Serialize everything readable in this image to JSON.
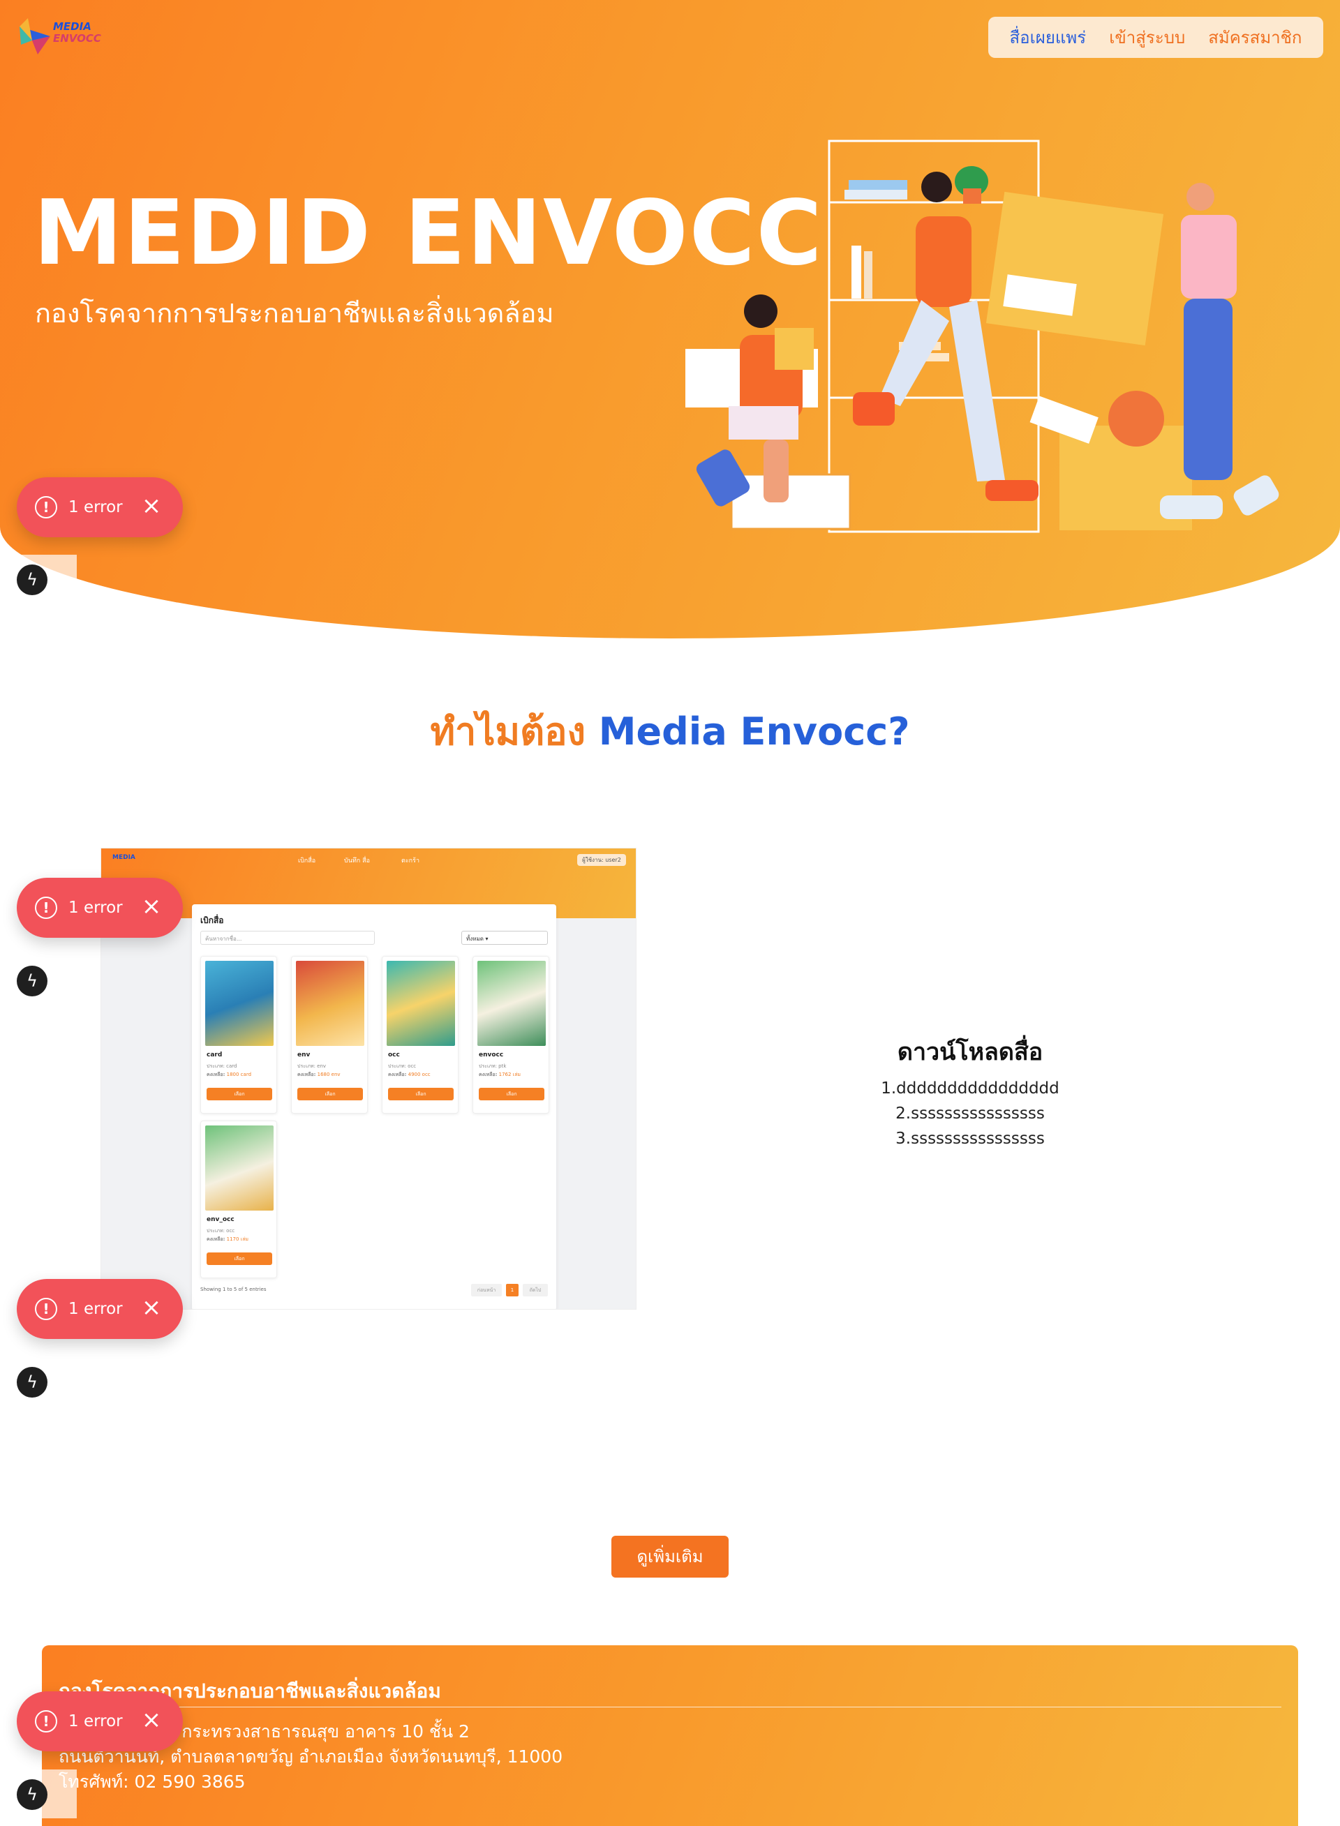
{
  "header": {
    "logo": {
      "line1": "MEDIA",
      "line2": "ENVOCC"
    },
    "nav": [
      {
        "label": "สื่อเผยแพร่",
        "active": true
      },
      {
        "label": "เข้าสู่ระบบ",
        "active": false
      },
      {
        "label": "สมัครสมาชิก",
        "active": false
      }
    ]
  },
  "hero": {
    "title": "MEDID ENVOCC",
    "subtitle": "กองโรคจากการประกอบอาชีพและสิ่งแวดล้อม"
  },
  "toast": {
    "label": "1 error",
    "icon": "error-circle-icon",
    "close_icon": "close-icon",
    "color": "#f25259"
  },
  "why": {
    "prefix": "ทำไมต้อง",
    "brand": "Media Envocc?"
  },
  "preview": {
    "nav": [
      "เบิกสื่อ",
      "บันทึก สื่อ",
      "ตะกร้า"
    ],
    "user": "ผู้ใช้งาน: user2",
    "heading": "เบิกสื่อ",
    "search_placeholder": "ค้นหาจากชื่อ...",
    "select_value": "ทั้งหมด",
    "cards": [
      {
        "name": "card",
        "type": "ประเภท: card",
        "stock_label": "คงเหลือ:",
        "stock": "1800 card",
        "button": "เลือก"
      },
      {
        "name": "env",
        "type": "ประเภท: env",
        "stock_label": "คงเหลือ:",
        "stock": "1680 env",
        "button": "เลือก"
      },
      {
        "name": "occ",
        "type": "ประเภท: occ",
        "stock_label": "คงเหลือ:",
        "stock": "4900 occ",
        "button": "เลือก"
      },
      {
        "name": "envocc",
        "type": "ประเภท: ptk",
        "stock_label": "คงเหลือ:",
        "stock": "1762 เล่ม",
        "button": "เลือก"
      },
      {
        "name": "env_occ",
        "type": "ประเภท: occ",
        "stock_label": "คงเหลือ:",
        "stock": "1170 เล่ม",
        "button": "เลือก"
      }
    ],
    "footer_text": "Showing 1 to 5 of 5 entries",
    "pager": {
      "prev": "ก่อนหน้า",
      "page": "1",
      "next": "ถัดไป"
    }
  },
  "download": {
    "title": "ดาวน์โหลดสื่อ",
    "items": [
      "1.dddddddddddddddd",
      "2.ssssssssssssssss",
      "3.ssssssssssssssss"
    ]
  },
  "more_button": "ดูเพิ่มเติม",
  "footer": {
    "title": "กองโรคจากการประกอบอาชีพและสิ่งแวดล้อม",
    "address1": "กรมควบคุมโรค กระทรวงสาธารณสุข อาคาร 10 ชั้น 2",
    "address2": "ถนนติวานนท์, ตำบลตลาดขวัญ อำเภอเมือง จังหวัดนนทบุรี, 11000",
    "phone": "โทรศัพท์: 02 590 3865"
  },
  "colors": {
    "accent_orange": "#f47321",
    "brand_blue": "#2660d9",
    "hero_start": "#fb7f22",
    "hero_end": "#f6b73d"
  }
}
